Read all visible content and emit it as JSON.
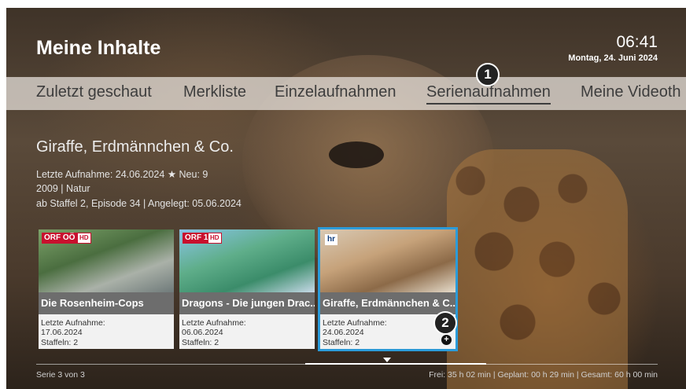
{
  "header": {
    "title": "Meine Inhalte",
    "time": "06:41",
    "date": "Montag, 24. Juni 2024"
  },
  "tabs": [
    {
      "label": "Zuletzt geschaut",
      "active": false
    },
    {
      "label": "Merkliste",
      "active": false
    },
    {
      "label": "Einzelaufnahmen",
      "active": false
    },
    {
      "label": "Serienaufnahmen",
      "active": true
    },
    {
      "label": "Meine Videoth",
      "active": false
    }
  ],
  "badges": {
    "one": "1",
    "two": "2"
  },
  "detail": {
    "title": "Giraffe, Erdmännchen & Co.",
    "line1": "Letzte Aufnahme: 24.06.2024",
    "new_label": "Neu: 9",
    "line2": "2009 | Natur",
    "line3": "ab Staffel 2, Episode 34 | Angelegt: 05.06.2024"
  },
  "cards": [
    {
      "channel": "ORF",
      "channel_sub": "OÖ",
      "hd": "HD",
      "title": "Die Rosenheim-Cops",
      "last_label": "Letzte Aufnahme:",
      "last_date": "17.06.2024",
      "seasons": "Staffeln: 2"
    },
    {
      "channel": "ORF",
      "channel_sub": "1",
      "hd": "HD",
      "title": "Dragons - Die jungen Drac..",
      "last_label": "Letzte Aufnahme:",
      "last_date": "06.06.2024",
      "seasons": "Staffeln: 2"
    },
    {
      "channel": "hr",
      "title": "Giraffe, Erdmännchen & C..",
      "last_label": "Letzte Aufnahme:",
      "last_date": "24.06.2024",
      "seasons": "Staffeln: 2"
    }
  ],
  "footer": {
    "left": "Serie 3 von 3",
    "right": "Frei: 35 h 02 min  |  Geplant: 00 h 29 min  |  Gesamt: 60 h 00 min"
  },
  "colors": {
    "focus": "#2b9bd9",
    "orf_red": "#c8102e"
  },
  "icons": {
    "star": "star-icon",
    "plus": "plus-circle-icon",
    "arrow": "chevron-down-icon"
  }
}
